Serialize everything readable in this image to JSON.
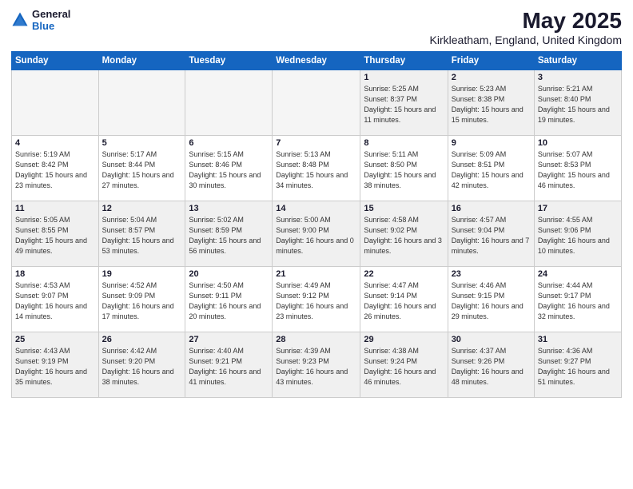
{
  "header": {
    "logo_general": "General",
    "logo_blue": "Blue",
    "month_title": "May 2025",
    "location": "Kirkleatham, England, United Kingdom"
  },
  "weekdays": [
    "Sunday",
    "Monday",
    "Tuesday",
    "Wednesday",
    "Thursday",
    "Friday",
    "Saturday"
  ],
  "weeks": [
    [
      {
        "day": "",
        "info": "",
        "empty": true
      },
      {
        "day": "",
        "info": "",
        "empty": true
      },
      {
        "day": "",
        "info": "",
        "empty": true
      },
      {
        "day": "",
        "info": "",
        "empty": true
      },
      {
        "day": "1",
        "info": "Sunrise: 5:25 AM\nSunset: 8:37 PM\nDaylight: 15 hours\nand 11 minutes.",
        "empty": false
      },
      {
        "day": "2",
        "info": "Sunrise: 5:23 AM\nSunset: 8:38 PM\nDaylight: 15 hours\nand 15 minutes.",
        "empty": false
      },
      {
        "day": "3",
        "info": "Sunrise: 5:21 AM\nSunset: 8:40 PM\nDaylight: 15 hours\nand 19 minutes.",
        "empty": false
      }
    ],
    [
      {
        "day": "4",
        "info": "Sunrise: 5:19 AM\nSunset: 8:42 PM\nDaylight: 15 hours\nand 23 minutes.",
        "empty": false
      },
      {
        "day": "5",
        "info": "Sunrise: 5:17 AM\nSunset: 8:44 PM\nDaylight: 15 hours\nand 27 minutes.",
        "empty": false
      },
      {
        "day": "6",
        "info": "Sunrise: 5:15 AM\nSunset: 8:46 PM\nDaylight: 15 hours\nand 30 minutes.",
        "empty": false
      },
      {
        "day": "7",
        "info": "Sunrise: 5:13 AM\nSunset: 8:48 PM\nDaylight: 15 hours\nand 34 minutes.",
        "empty": false
      },
      {
        "day": "8",
        "info": "Sunrise: 5:11 AM\nSunset: 8:50 PM\nDaylight: 15 hours\nand 38 minutes.",
        "empty": false
      },
      {
        "day": "9",
        "info": "Sunrise: 5:09 AM\nSunset: 8:51 PM\nDaylight: 15 hours\nand 42 minutes.",
        "empty": false
      },
      {
        "day": "10",
        "info": "Sunrise: 5:07 AM\nSunset: 8:53 PM\nDaylight: 15 hours\nand 46 minutes.",
        "empty": false
      }
    ],
    [
      {
        "day": "11",
        "info": "Sunrise: 5:05 AM\nSunset: 8:55 PM\nDaylight: 15 hours\nand 49 minutes.",
        "empty": false
      },
      {
        "day": "12",
        "info": "Sunrise: 5:04 AM\nSunset: 8:57 PM\nDaylight: 15 hours\nand 53 minutes.",
        "empty": false
      },
      {
        "day": "13",
        "info": "Sunrise: 5:02 AM\nSunset: 8:59 PM\nDaylight: 15 hours\nand 56 minutes.",
        "empty": false
      },
      {
        "day": "14",
        "info": "Sunrise: 5:00 AM\nSunset: 9:00 PM\nDaylight: 16 hours\nand 0 minutes.",
        "empty": false
      },
      {
        "day": "15",
        "info": "Sunrise: 4:58 AM\nSunset: 9:02 PM\nDaylight: 16 hours\nand 3 minutes.",
        "empty": false
      },
      {
        "day": "16",
        "info": "Sunrise: 4:57 AM\nSunset: 9:04 PM\nDaylight: 16 hours\nand 7 minutes.",
        "empty": false
      },
      {
        "day": "17",
        "info": "Sunrise: 4:55 AM\nSunset: 9:06 PM\nDaylight: 16 hours\nand 10 minutes.",
        "empty": false
      }
    ],
    [
      {
        "day": "18",
        "info": "Sunrise: 4:53 AM\nSunset: 9:07 PM\nDaylight: 16 hours\nand 14 minutes.",
        "empty": false
      },
      {
        "day": "19",
        "info": "Sunrise: 4:52 AM\nSunset: 9:09 PM\nDaylight: 16 hours\nand 17 minutes.",
        "empty": false
      },
      {
        "day": "20",
        "info": "Sunrise: 4:50 AM\nSunset: 9:11 PM\nDaylight: 16 hours\nand 20 minutes.",
        "empty": false
      },
      {
        "day": "21",
        "info": "Sunrise: 4:49 AM\nSunset: 9:12 PM\nDaylight: 16 hours\nand 23 minutes.",
        "empty": false
      },
      {
        "day": "22",
        "info": "Sunrise: 4:47 AM\nSunset: 9:14 PM\nDaylight: 16 hours\nand 26 minutes.",
        "empty": false
      },
      {
        "day": "23",
        "info": "Sunrise: 4:46 AM\nSunset: 9:15 PM\nDaylight: 16 hours\nand 29 minutes.",
        "empty": false
      },
      {
        "day": "24",
        "info": "Sunrise: 4:44 AM\nSunset: 9:17 PM\nDaylight: 16 hours\nand 32 minutes.",
        "empty": false
      }
    ],
    [
      {
        "day": "25",
        "info": "Sunrise: 4:43 AM\nSunset: 9:19 PM\nDaylight: 16 hours\nand 35 minutes.",
        "empty": false
      },
      {
        "day": "26",
        "info": "Sunrise: 4:42 AM\nSunset: 9:20 PM\nDaylight: 16 hours\nand 38 minutes.",
        "empty": false
      },
      {
        "day": "27",
        "info": "Sunrise: 4:40 AM\nSunset: 9:21 PM\nDaylight: 16 hours\nand 41 minutes.",
        "empty": false
      },
      {
        "day": "28",
        "info": "Sunrise: 4:39 AM\nSunset: 9:23 PM\nDaylight: 16 hours\nand 43 minutes.",
        "empty": false
      },
      {
        "day": "29",
        "info": "Sunrise: 4:38 AM\nSunset: 9:24 PM\nDaylight: 16 hours\nand 46 minutes.",
        "empty": false
      },
      {
        "day": "30",
        "info": "Sunrise: 4:37 AM\nSunset: 9:26 PM\nDaylight: 16 hours\nand 48 minutes.",
        "empty": false
      },
      {
        "day": "31",
        "info": "Sunrise: 4:36 AM\nSunset: 9:27 PM\nDaylight: 16 hours\nand 51 minutes.",
        "empty": false
      }
    ]
  ]
}
